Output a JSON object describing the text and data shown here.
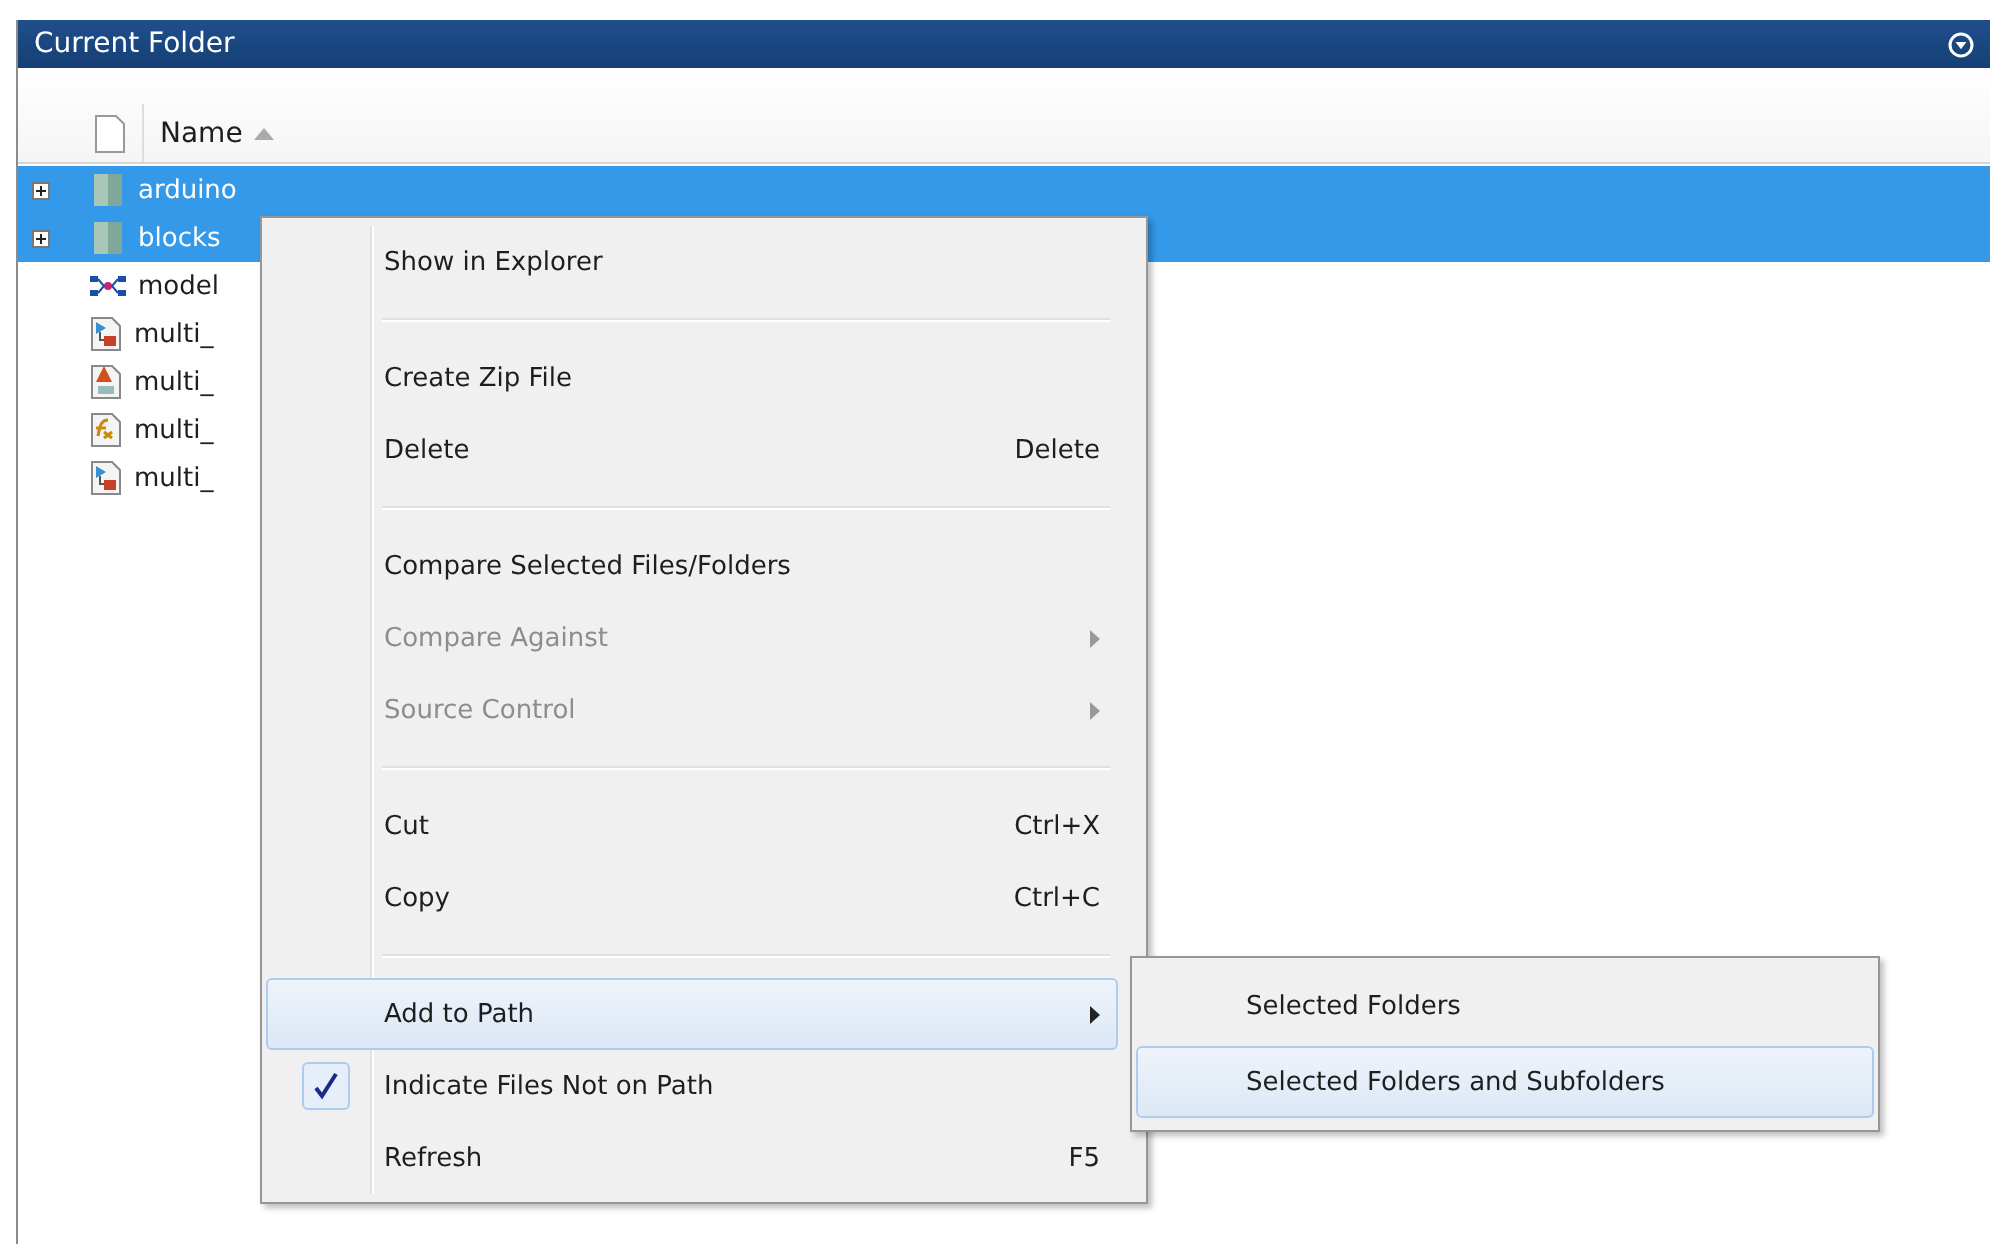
{
  "panel": {
    "title": "Current Folder"
  },
  "columns": [
    {
      "label": "Name",
      "sorted_ascending": true
    }
  ],
  "files": [
    {
      "name": "arduino",
      "kind": "folder",
      "expandable": true,
      "selected": true
    },
    {
      "name": "blocks",
      "kind": "folder",
      "expandable": true,
      "selected": true
    },
    {
      "name": "model",
      "kind": "model",
      "expandable": false,
      "selected": false
    },
    {
      "name": "multi_",
      "kind": "simulink",
      "expandable": false,
      "selected": false
    },
    {
      "name": "multi_",
      "kind": "app",
      "expandable": false,
      "selected": false
    },
    {
      "name": "multi_",
      "kind": "function",
      "expandable": false,
      "selected": false
    },
    {
      "name": "multi_",
      "kind": "simulink",
      "expandable": false,
      "selected": false
    }
  ],
  "context_menu": [
    {
      "kind": "item",
      "label": "Show in Explorer",
      "disabled": false,
      "checked": false,
      "selected": false,
      "submenu": false
    },
    {
      "kind": "separator"
    },
    {
      "kind": "item",
      "label": "Create Zip File",
      "disabled": false,
      "checked": false,
      "selected": false,
      "submenu": false
    },
    {
      "kind": "item",
      "label": "Delete",
      "shortcut": "Delete",
      "disabled": false,
      "checked": false,
      "selected": false,
      "submenu": false
    },
    {
      "kind": "separator"
    },
    {
      "kind": "item",
      "label": "Compare Selected Files/Folders",
      "disabled": false,
      "checked": false,
      "selected": false,
      "submenu": false
    },
    {
      "kind": "item",
      "label": "Compare Against",
      "disabled": true,
      "checked": false,
      "selected": false,
      "submenu": true
    },
    {
      "kind": "item",
      "label": "Source Control",
      "disabled": true,
      "checked": false,
      "selected": false,
      "submenu": true
    },
    {
      "kind": "separator"
    },
    {
      "kind": "item",
      "label": "Cut",
      "shortcut": "Ctrl+X",
      "disabled": false,
      "checked": false,
      "selected": false,
      "submenu": false
    },
    {
      "kind": "item",
      "label": "Copy",
      "shortcut": "Ctrl+C",
      "disabled": false,
      "checked": false,
      "selected": false,
      "submenu": false
    },
    {
      "kind": "separator"
    },
    {
      "kind": "item",
      "label": "Add to Path",
      "disabled": false,
      "checked": false,
      "selected": true,
      "submenu": true
    },
    {
      "kind": "item",
      "label": "Indicate Files Not on Path",
      "disabled": false,
      "checked": true,
      "selected": false,
      "submenu": false
    },
    {
      "kind": "item",
      "label": "Refresh",
      "shortcut": "F5",
      "disabled": false,
      "checked": false,
      "selected": false,
      "submenu": false
    }
  ],
  "submenu": [
    {
      "label": "Selected Folders",
      "selected": false
    },
    {
      "label": "Selected Folders and Subfolders",
      "selected": true
    }
  ]
}
